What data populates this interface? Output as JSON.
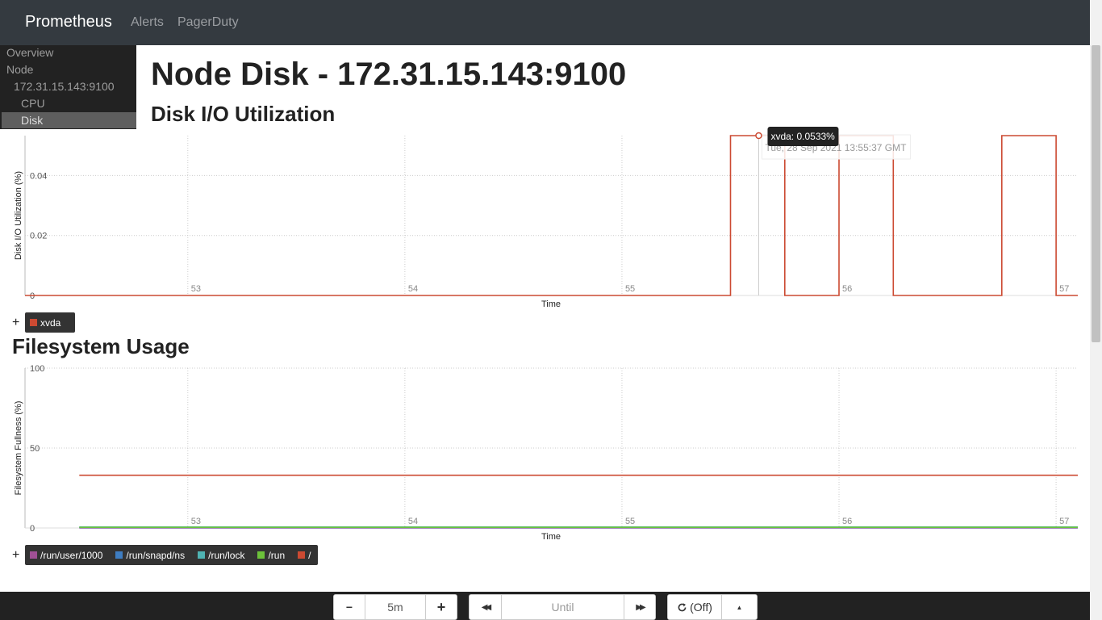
{
  "navbar": {
    "brand": "Prometheus",
    "links": [
      "Alerts",
      "PagerDuty"
    ]
  },
  "sidebar": {
    "items": [
      "Overview",
      "Node",
      "172.31.15.143:9100",
      "CPU",
      "Disk"
    ],
    "active": "Disk"
  },
  "page_title": "Node Disk - 172.31.15.143:9100",
  "charts": [
    {
      "title": "Disk I/O Utilization",
      "ylabel": "Disk I/O Utilization (%)",
      "xlabel": "Time",
      "x_ticks": [
        "53",
        "54",
        "55",
        "56",
        "57"
      ],
      "y_ticks": [
        "0",
        "0.02",
        "0.04"
      ],
      "hover": {
        "label": "xvda: 0.0533%",
        "timestamp": "Tue, 28 Sep 2021 13:55:37 GMT"
      },
      "legend": [
        {
          "label": "xvda",
          "color": "#cc4a32"
        }
      ]
    },
    {
      "title": "Filesystem Usage",
      "ylabel": "Filesystem Fullness (%)",
      "xlabel": "Time",
      "x_ticks": [
        "53",
        "54",
        "55",
        "56",
        "57"
      ],
      "y_ticks": [
        "0",
        "50",
        "100"
      ],
      "legend": [
        {
          "label": "/run/user/1000",
          "color": "#a05095"
        },
        {
          "label": "/run/snapd/ns",
          "color": "#3e7dc1"
        },
        {
          "label": "/run/lock",
          "color": "#4fb3b3"
        },
        {
          "label": "/run",
          "color": "#6cc13a"
        },
        {
          "label": "/",
          "color": "#cc4a32"
        }
      ]
    }
  ],
  "chart_data": [
    {
      "type": "line",
      "title": "Disk I/O Utilization",
      "xlabel": "Time",
      "ylabel": "Disk I/O Utilization (%)",
      "x_unit": "minute",
      "ylim": [
        0,
        0.0533
      ],
      "grid": true,
      "series": [
        {
          "name": "xvda",
          "color": "#cc4a32",
          "x": [
            52.25,
            55.5,
            55.5,
            55.75,
            55.75,
            56.0,
            56.0,
            56.25,
            56.25,
            56.75,
            56.75,
            57.0,
            57.0,
            57.1
          ],
          "values": [
            0,
            0,
            0.0533,
            0.0533,
            0,
            0,
            0.0533,
            0.0533,
            0,
            0,
            0.0533,
            0.0533,
            0,
            0
          ]
        }
      ]
    },
    {
      "type": "line",
      "title": "Filesystem Usage",
      "xlabel": "Time",
      "ylabel": "Filesystem Fullness (%)",
      "x_unit": "minute",
      "ylim": [
        0,
        100
      ],
      "grid": true,
      "series": [
        {
          "name": "/run/user/1000",
          "color": "#a05095",
          "x": [
            52.5,
            57.1
          ],
          "values": [
            0,
            0
          ]
        },
        {
          "name": "/run/snapd/ns",
          "color": "#3e7dc1",
          "x": [
            52.5,
            57.1
          ],
          "values": [
            0.3,
            0.3
          ]
        },
        {
          "name": "/run/lock",
          "color": "#4fb3b3",
          "x": [
            52.5,
            57.1
          ],
          "values": [
            0.6,
            0.6
          ]
        },
        {
          "name": "/run",
          "color": "#6cc13a",
          "x": [
            52.5,
            57.1
          ],
          "values": [
            0.4,
            0.4
          ]
        },
        {
          "name": "/",
          "color": "#cc4a32",
          "x": [
            52.5,
            57.1
          ],
          "values": [
            33,
            33
          ]
        }
      ]
    }
  ],
  "controls": {
    "minus_label": "−",
    "range_value": "5m",
    "plus_label": "+",
    "back_label": "◀◀",
    "until_placeholder": "Until",
    "forward_label": "▶▶",
    "refresh_label": "(Off)",
    "caret_label": "▲"
  }
}
